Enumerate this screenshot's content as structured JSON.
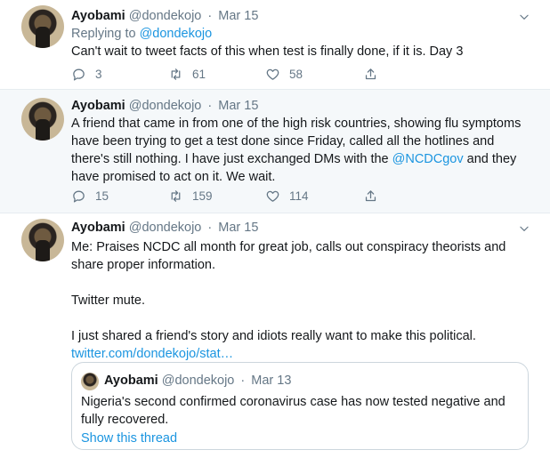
{
  "tweets": [
    {
      "name": "Ayobami",
      "handle": "@dondekojo",
      "date": "Mar 15",
      "replying_prefix": "Replying to ",
      "replying_handle": "@dondekojo",
      "text": "Can't wait to tweet facts of this when test is finally done, if it is. Day 3",
      "replies": "3",
      "retweets": "61",
      "likes": "58"
    },
    {
      "name": "Ayobami",
      "handle": "@dondekojo",
      "date": "Mar 15",
      "text_before": "A friend that came in from one of the high risk countries, showing flu symptoms have been trying to get a test done since Friday, called all the hotlines and there's still nothing. I have just exchanged DMs with the ",
      "mention": "@NCDCgov",
      "text_after": " and they have promised to act on it. We wait.",
      "replies": "15",
      "retweets": "159",
      "likes": "114"
    },
    {
      "name": "Ayobami",
      "handle": "@dondekojo",
      "date": "Mar 15",
      "para1": "Me: Praises NCDC all month for great job, calls out conspiracy theorists and share proper information.",
      "para2": "Twitter mute.",
      "para3": "I just shared a friend's story and idiots really want to make this political.",
      "link": "twitter.com/dondekojo/stat…",
      "quote": {
        "name": "Ayobami",
        "handle": "@dondekojo",
        "date": "Mar 13",
        "text": "Nigeria's second confirmed coronavirus case has now tested negative and fully recovered.",
        "show_thread": "Show this thread"
      }
    }
  ],
  "separator": "·",
  "icons": {
    "reply": "reply-icon",
    "retweet": "retweet-icon",
    "like": "heart-icon",
    "share": "share-icon",
    "menu": "chevron-down-icon"
  },
  "colors": {
    "link": "#1b95e0",
    "muted": "#657786",
    "highlight_bg": "#f5f8fa"
  }
}
